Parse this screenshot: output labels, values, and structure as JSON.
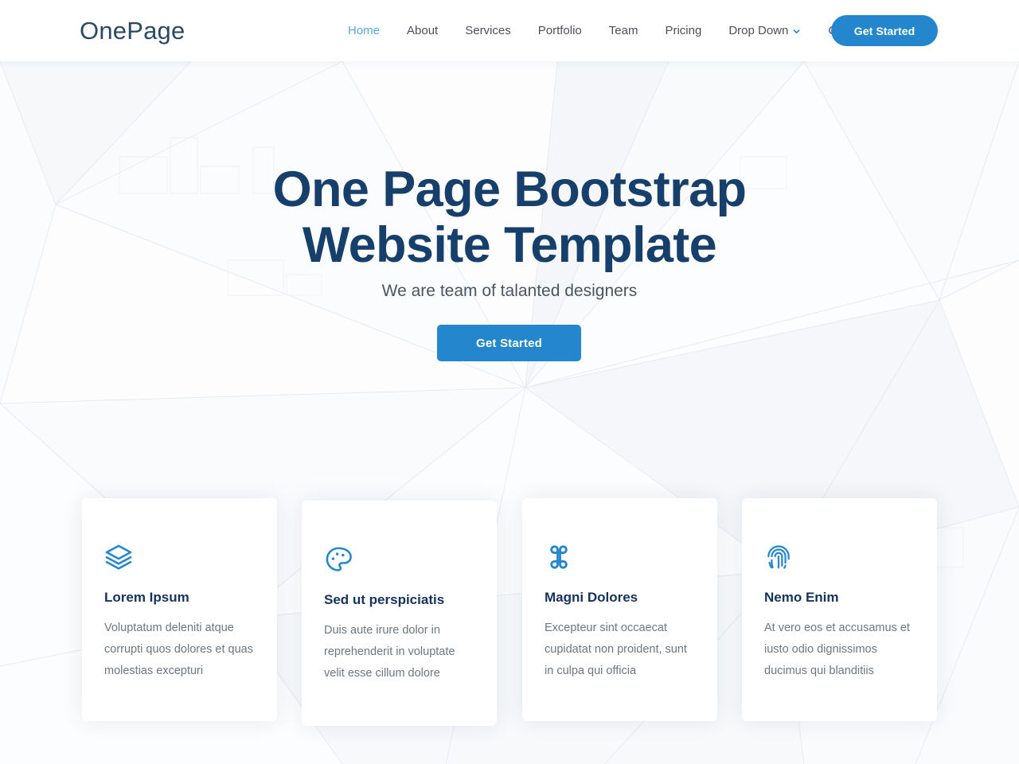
{
  "header": {
    "brand": "OnePage",
    "nav": [
      {
        "label": "Home",
        "active": true,
        "dropdown": false
      },
      {
        "label": "About",
        "active": false,
        "dropdown": false
      },
      {
        "label": "Services",
        "active": false,
        "dropdown": false
      },
      {
        "label": "Portfolio",
        "active": false,
        "dropdown": false
      },
      {
        "label": "Team",
        "active": false,
        "dropdown": false
      },
      {
        "label": "Pricing",
        "active": false,
        "dropdown": false
      },
      {
        "label": "Drop Down",
        "active": false,
        "dropdown": true
      },
      {
        "label": "Contact",
        "active": false,
        "dropdown": false
      }
    ],
    "cta_label": "Get Started",
    "dropdown_icon": "chevron-down-icon"
  },
  "hero": {
    "title_line1": "One Page Bootstrap",
    "title_line2": "Website Template",
    "subtitle": "We are team of talanted designers",
    "cta_label": "Get Started"
  },
  "cards": [
    {
      "icon": "layers-icon",
      "title": "Lorem Ipsum",
      "text": "Voluptatum deleniti atque corrupti quos dolores et quas molestias excepturi"
    },
    {
      "icon": "palette-icon",
      "title": "Sed ut perspiciatis",
      "text": "Duis aute irure dolor in reprehenderit in voluptate velit esse cillum dolore"
    },
    {
      "icon": "command-icon",
      "title": "Magni Dolores",
      "text": "Excepteur sint occaecat cupidatat non proident, sunt in culpa qui officia"
    },
    {
      "icon": "fingerprint-icon",
      "title": "Nemo Enim",
      "text": "At vero eos et accusamus et iusto odio dignissimos ducimus qui blanditiis"
    }
  ],
  "colors": {
    "accent": "#2487ce",
    "brand_text": "#2c4964",
    "heading_navy": "#16406b",
    "card_title": "#16335c",
    "body_text": "#6e7680",
    "nav_active": "#5aa1e3",
    "background": "#ffffff"
  }
}
